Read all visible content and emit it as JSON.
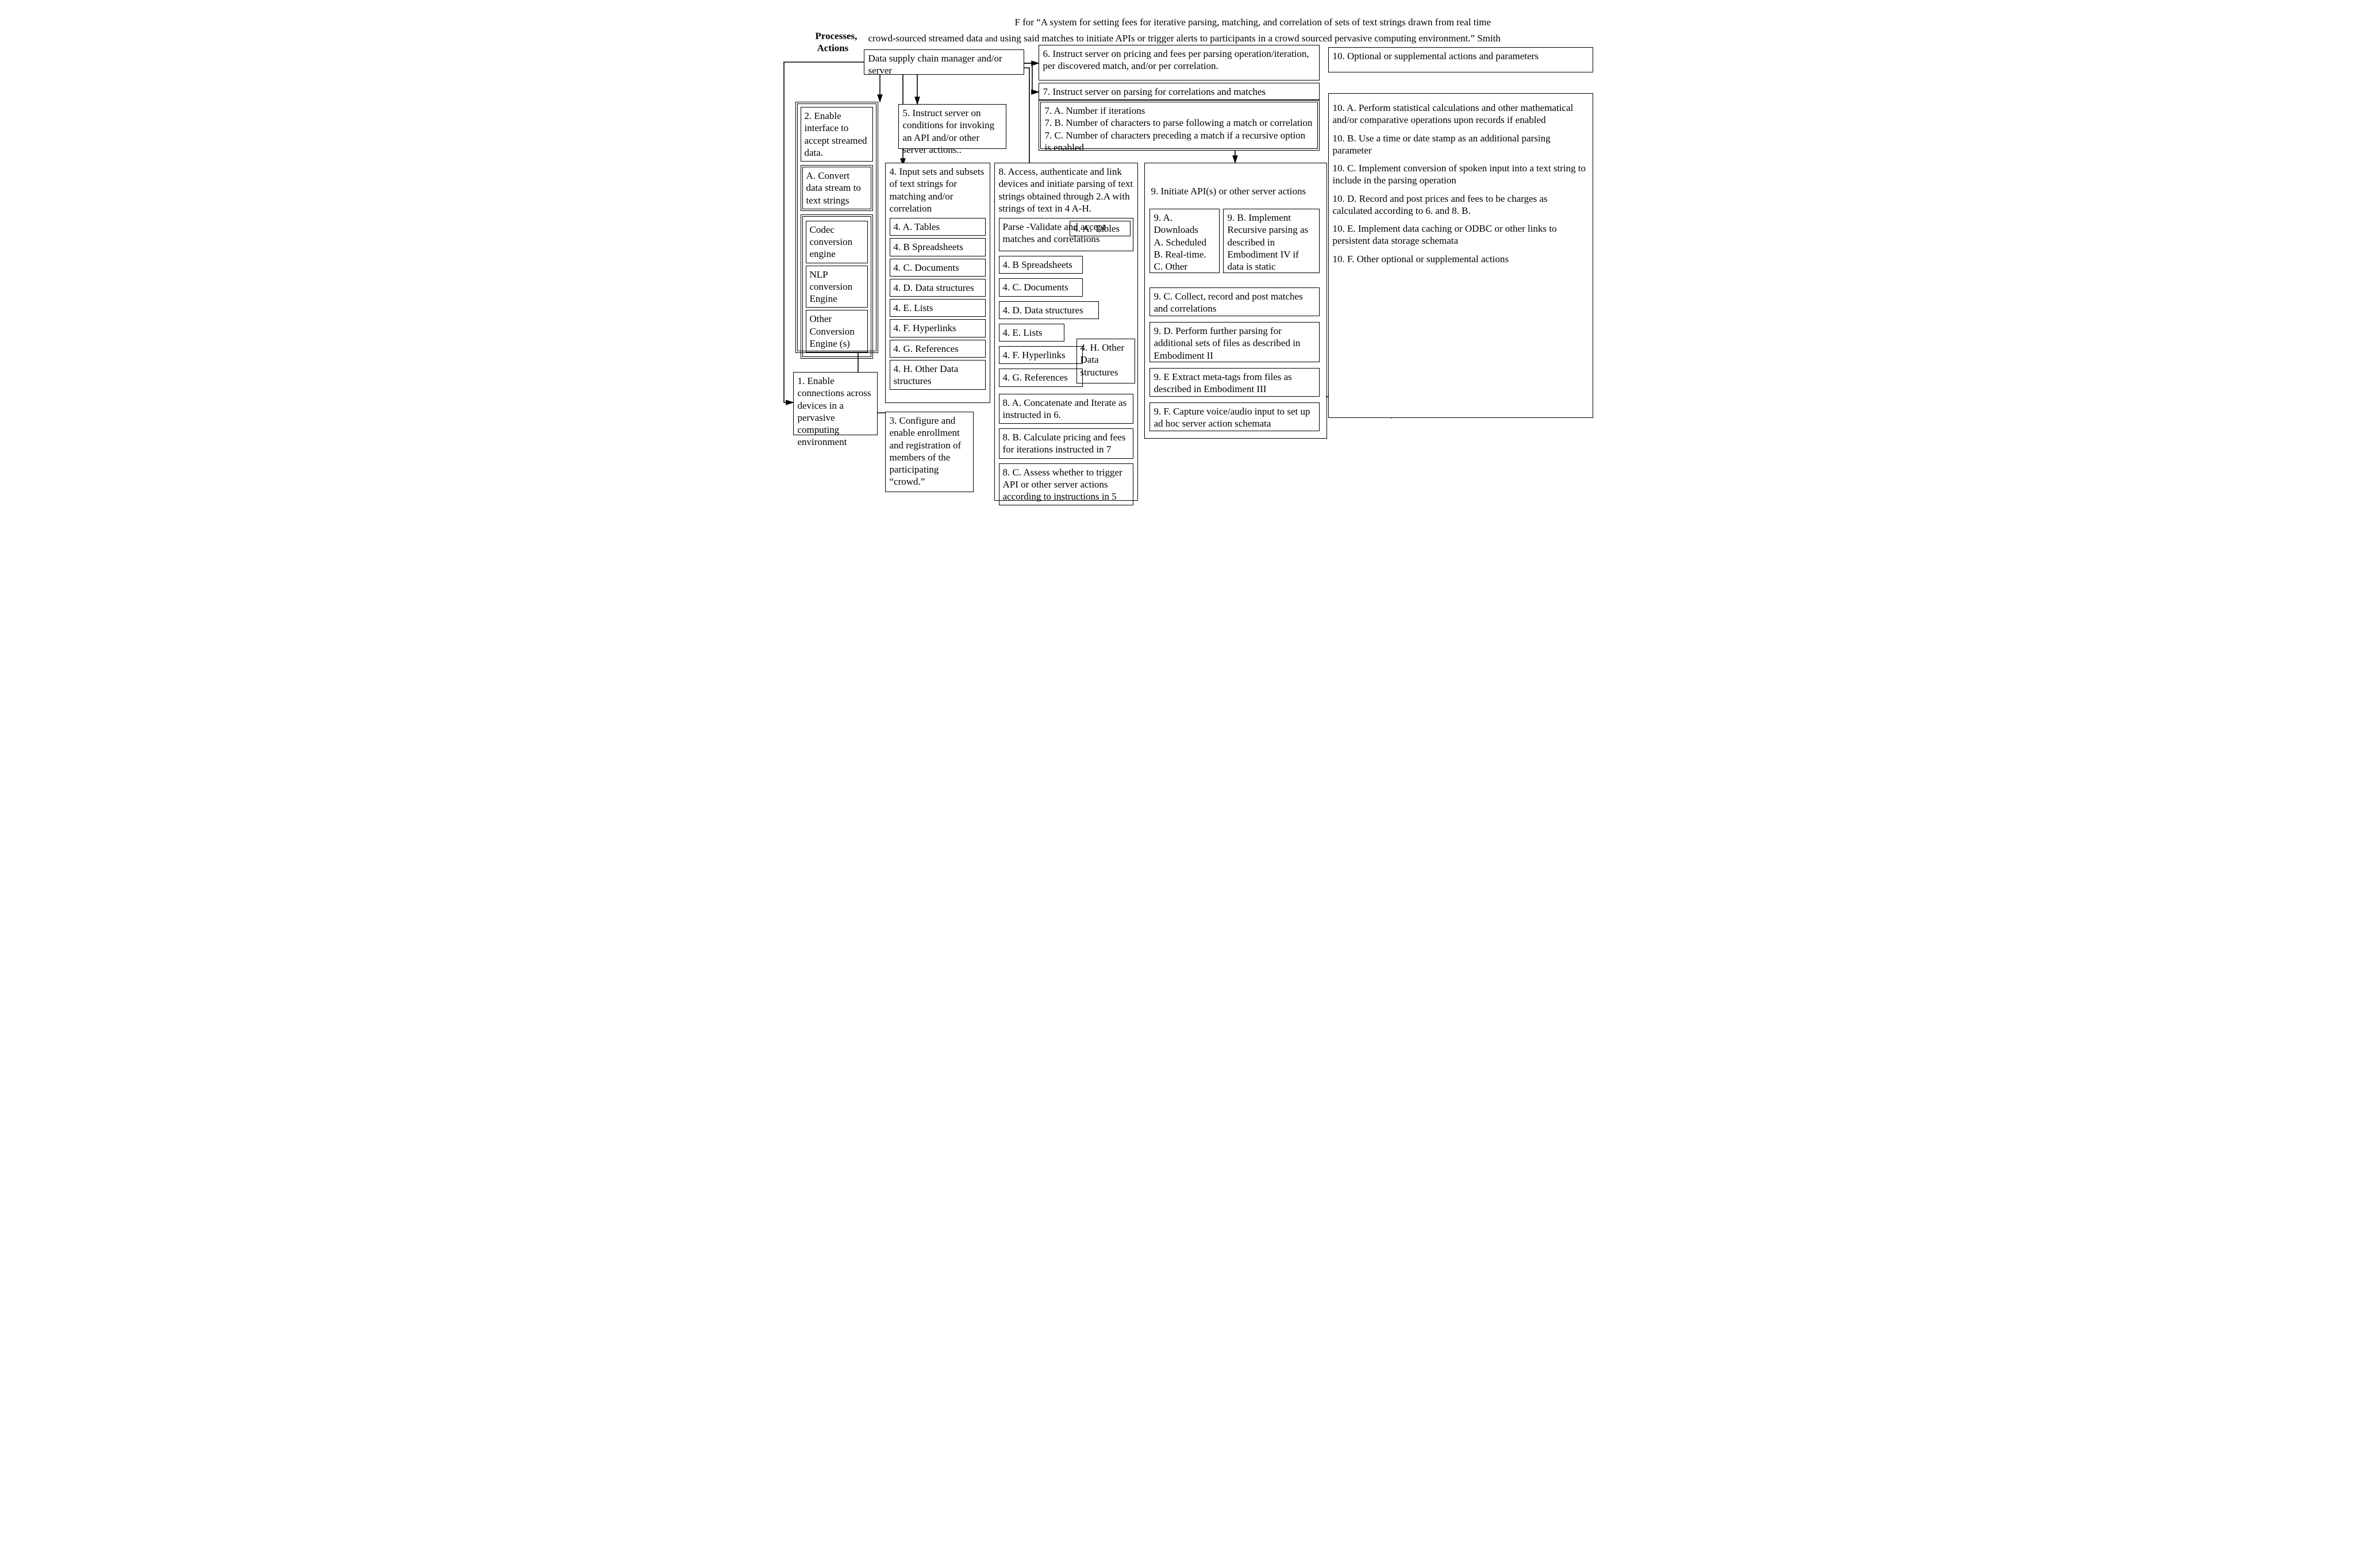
{
  "title": {
    "line1": "F for “A system for setting fees for iterative parsing, matching, and correlation of sets of text strings drawn from real time",
    "line2_a": "crowd-sourced streamed data ",
    "line2_and": "and",
    "line2_b": " using said matches to initiate APIs or trigger alerts to participants in a crowd sourced pervasive computing environment.”  Smith"
  },
  "labels": {
    "processes1": "Processes,",
    "processes2": "Actions"
  },
  "b0": "Data supply chain manager and/or server",
  "b1": "1. Enable connections across devices in a pervasive computing environment",
  "b2": {
    "hdr": "2. Enable interface to accept streamed data.",
    "a": "A. Convert data stream  to text strings",
    "c1": "Codec conversion engine",
    "c2": "NLP conversion Engine",
    "c3": "Other Conversion Engine (s)"
  },
  "b3": "3. Configure and enable enrollment and  registration of members of the participating “crowd.”",
  "b4": {
    "hdr": "4. Input sets and subsets of text strings for matching and/or correlation",
    "a": "4. A. Tables",
    "b": "4. B Spreadsheets",
    "c": "4. C. Documents",
    "d": "4. D. Data structures",
    "e": "4. E. Lists",
    "f": "4. F. Hyperlinks",
    "g": "4. G. References",
    "h": "4. H. Other Data structures"
  },
  "b5": "5. Instruct server on conditions for invoking an API and/or other server actions..",
  "b6": "6. Instruct server on pricing and fees per  parsing operation/iteration, per discovered match, and/or per correlation.",
  "b7": {
    "hdr": "7. Instruct server on parsing for correlations and matches",
    "a": "7. A.  Number if iterations",
    "b": "7. B.  Number of characters to parse following a match or correlation",
    "c": "7. C. Number of characters preceding a match if a recursive option is enabled"
  },
  "b8": {
    "hdr": "8. Access, authenticate and link devices and initiate parsing of text strings obtained through 2.A with strings of text in 4 A-H.",
    "parse": "Parse -Validate and accept matches and correlations",
    "inset": "4. A. Tables",
    "side": "4. H. Other Data structures",
    "b": "4. B Spreadsheets",
    "c": "4. C. Documents",
    "d": "4. D. Data structures",
    "e": "4. E. Lists",
    "f": "4. F. Hyperlinks",
    "g": "4. G. References",
    "s8a": "8. A. Concatenate and Iterate as instructed in 6.",
    "s8b": "8. B. Calculate pricing and fees for iterations instructed in 7",
    "s8c": "8. C. Assess whether to trigger API or other server actions according to instructions in 5"
  },
  "b9": {
    "hdr": "9. Initiate API(s) or other server actions",
    "a": "9. A. Downloads\nA.  Scheduled\nB.  Real-time.\nC.  Other",
    "b": "9. B. Implement Recursive parsing as described in Embodiment IV if data is static",
    "c": "9. C. Collect, record and post matches and correlations",
    "d": "9. D.  Perform further parsing for additional sets of files as described in Embodiment II",
    "e": "9. E  Extract meta-tags from files as described in Embodiment III",
    "f": "9. F. Capture voice/audio input to set up ad hoc server action schemata"
  },
  "b10": {
    "hdr": "10. Optional or supplemental actions and parameters",
    "a": "10. A. Perform statistical calculations and other mathematical and/or comparative operations upon records if enabled",
    "b": "10. B. Use a time or date stamp as an additional parsing parameter",
    "c": "10. C. Implement conversion of spoken input into a text string to include in the parsing operation",
    "d": "10. D.  Record and post prices and fees to be charges as calculated according to 6. and 8. B.",
    "e": "10. E.  Implement data caching or ODBC or other links to persistent data storage schemata",
    "f": "10. F. Other optional or supplemental actions"
  }
}
